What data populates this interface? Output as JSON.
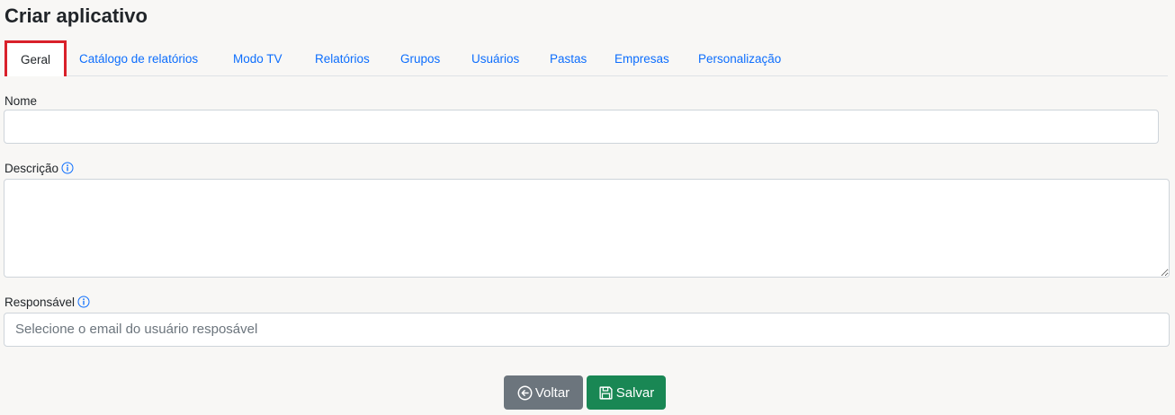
{
  "page": {
    "title": "Criar aplicativo"
  },
  "tabs": [
    {
      "label": "Geral",
      "active": true
    },
    {
      "label": "Catálogo de relatórios"
    },
    {
      "label": "Modo TV"
    },
    {
      "label": "Relatórios"
    },
    {
      "label": "Grupos"
    },
    {
      "label": "Usuários"
    },
    {
      "label": "Pastas"
    },
    {
      "label": "Empresas"
    },
    {
      "label": "Personalização"
    }
  ],
  "form": {
    "name": {
      "label": "Nome",
      "value": ""
    },
    "description": {
      "label": "Descrição",
      "value": "",
      "icon": "info-icon"
    },
    "owner": {
      "label": "Responsável",
      "placeholder": "Selecione o email do usuário resposável",
      "icon": "info-icon"
    }
  },
  "actions": {
    "back_label": "Voltar",
    "back_icon": "arrow-left-circle-icon",
    "save_label": "Salvar",
    "save_icon": "floppy-disk-icon"
  },
  "colors": {
    "background": "#f8f7f5",
    "link": "#0d6efd",
    "active_tab_highlight": "#d9202a",
    "back_button": "#6c757d",
    "save_button": "#198754"
  }
}
